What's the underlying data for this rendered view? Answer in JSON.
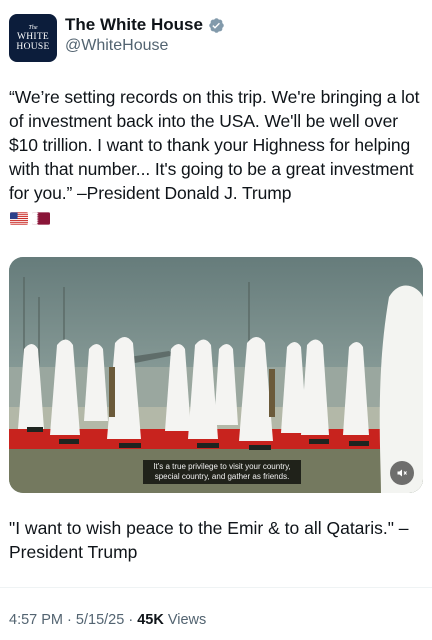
{
  "account": {
    "avatar_text": [
      "The",
      "WHITE",
      "HOUSE"
    ],
    "name": "The White House",
    "handle": "@WhiteHouse",
    "verified_icon": "verified-badge-icon (gray check)"
  },
  "tweet": {
    "text": "“We’re setting records on this trip. We're bringing a lot of investment back into the USA. We'll be well over $10 trillion. I want to thank your Highness for helping with that number... It's going to be a great investment for you.” –President Donald J. Trump",
    "flags": [
      "us-flag-icon",
      "qatar-flag-icon"
    ]
  },
  "video": {
    "caption": "It's a true privilege to visit your country, special country, and gather as friends.",
    "sound_icon": "speaker-muted-icon"
  },
  "quote_text": "\"I want to wish peace to the Emir & to all Qataris.\" –President Trump",
  "meta": {
    "time": "4:57 PM",
    "date": "5/15/25",
    "separator": "·",
    "views_count": "45K",
    "views_label": "Views"
  },
  "colors": {
    "text": "#0f1419",
    "secondary": "#536471",
    "avatar_bg": "#0c1d3b",
    "carpet": "#c8231e"
  }
}
